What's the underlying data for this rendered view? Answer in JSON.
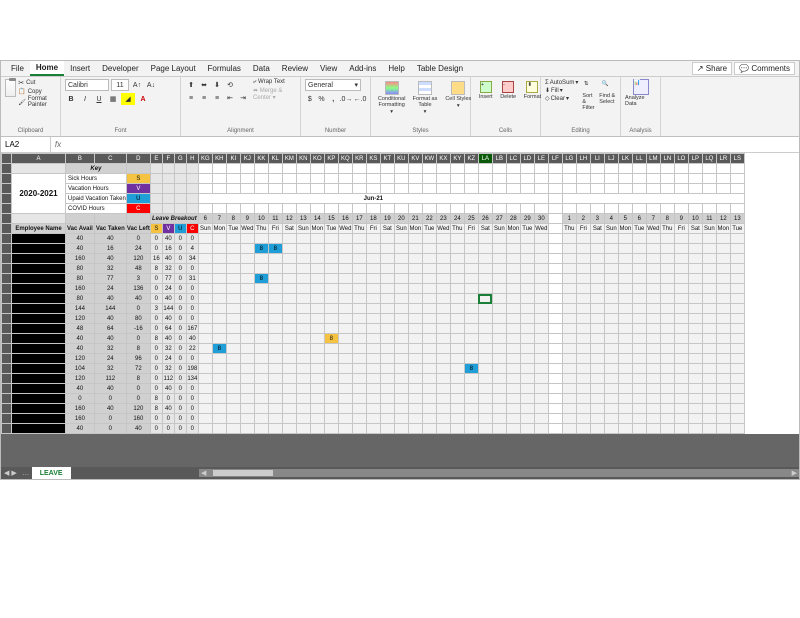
{
  "tabs": [
    "File",
    "Home",
    "Insert",
    "Developer",
    "Page Layout",
    "Formulas",
    "Data",
    "Review",
    "View",
    "Add-ins",
    "Help",
    "Table Design"
  ],
  "active_tab": "Home",
  "share": "Share",
  "comments": "Comments",
  "ribbon": {
    "clipboard": {
      "label": "Clipboard",
      "cut": "Cut",
      "copy": "Copy",
      "fp": "Format Painter"
    },
    "font": {
      "label": "Font",
      "name": "Calibri",
      "size": "11",
      "increase": "A",
      "decrease": "A"
    },
    "alignment": {
      "label": "Alignment",
      "wrap": "Wrap Text",
      "merge": "Merge & Center"
    },
    "number": {
      "label": "Number",
      "general": "General"
    },
    "styles": {
      "label": "Styles",
      "cond": "Conditional Formatting",
      "fat": "Format as Table",
      "cell": "Cell Styles"
    },
    "cells": {
      "label": "Cells",
      "insert": "Insert",
      "delete": "Delete",
      "format": "Format"
    },
    "editing": {
      "label": "Editing",
      "autosum": "AutoSum",
      "fill": "Fill",
      "clear": "Clear",
      "sort": "Sort & Filter",
      "find": "Find & Select"
    },
    "analysis": {
      "label": "Analysis",
      "analyze": "Analyze Data"
    }
  },
  "name_box": "LA2",
  "columns": [
    "A",
    "B",
    "C",
    "D",
    "E",
    "F",
    "G",
    "H",
    "KG",
    "KH",
    "KI",
    "KJ",
    "KK",
    "KL",
    "KM",
    "KN",
    "KO",
    "KP",
    "KQ",
    "KR",
    "KS",
    "KT",
    "KU",
    "KV",
    "KW",
    "KX",
    "KY",
    "KZ",
    "LA",
    "LB",
    "LC",
    "LD",
    "LE",
    "LF",
    "LG",
    "LH",
    "LI",
    "LJ",
    "LK",
    "LL",
    "LM",
    "LN",
    "LO",
    "LP",
    "LQ",
    "LR",
    "LS"
  ],
  "selected_col": "LA",
  "key": {
    "title": "Key",
    "rows": [
      {
        "label": "Sick Hours",
        "code": "S",
        "cls": "yellow"
      },
      {
        "label": "Vacation Hours",
        "code": "V",
        "cls": "purple"
      },
      {
        "label": "Upaid Vacation Taken",
        "code": "U",
        "cls": "blue"
      },
      {
        "label": "COVID Hours",
        "code": "C",
        "cls": "red"
      }
    ]
  },
  "year": "2020-2021",
  "leave_breakout": "Leave Breakout",
  "month": "Jun-21",
  "data_hdr": {
    "emp": "Employee Name",
    "va": "Vac Avail",
    "vt": "Vac Taken",
    "vl": "Vac Left",
    "s": "S",
    "v": "V",
    "u": "U",
    "c": "C"
  },
  "days": [
    "6",
    "7",
    "8",
    "9",
    "10",
    "11",
    "12",
    "13",
    "14",
    "15",
    "16",
    "17",
    "18",
    "19",
    "20",
    "21",
    "22",
    "23",
    "24",
    "25",
    "26",
    "27",
    "28",
    "29",
    "30",
    "",
    "1",
    "2",
    "3",
    "4",
    "5",
    "6",
    "7",
    "8",
    "9",
    "10",
    "11",
    "12",
    "13"
  ],
  "dow": [
    "Sun",
    "Mon",
    "Tue",
    "Wed",
    "Thu",
    "Fri",
    "Sat",
    "Sun",
    "Mon",
    "Tue",
    "Wed",
    "Thu",
    "Fri",
    "Sat",
    "Sun",
    "Mon",
    "Tue",
    "Wed",
    "Thu",
    "Fri",
    "Sat",
    "Sun",
    "Mon",
    "Tue",
    "Wed",
    "",
    "Thu",
    "Fri",
    "Sat",
    "Sun",
    "Mon",
    "Tue",
    "Wed",
    "Thu",
    "Fri",
    "Sat",
    "Sun",
    "Mon",
    "Tue"
  ],
  "rows": [
    {
      "va": "40",
      "vt": "40",
      "vl": "0",
      "s": "0",
      "v": "40",
      "u": "0",
      "c": "0",
      "cells": {}
    },
    {
      "va": "40",
      "vt": "16",
      "vl": "24",
      "s": "0",
      "v": "16",
      "u": "0",
      "c": "4",
      "cells": {
        "4": "8",
        "5": "8"
      }
    },
    {
      "va": "160",
      "vt": "40",
      "vl": "120",
      "s": "16",
      "v": "40",
      "u": "0",
      "c": "34",
      "cells": {}
    },
    {
      "va": "80",
      "vt": "32",
      "vl": "48",
      "s": "8",
      "v": "32",
      "u": "0",
      "c": "0",
      "cells": {}
    },
    {
      "va": "80",
      "vt": "77",
      "vl": "3",
      "s": "0",
      "v": "77",
      "u": "0",
      "c": "31",
      "cells": {
        "4": "8"
      }
    },
    {
      "va": "160",
      "vt": "24",
      "vl": "136",
      "s": "0",
      "v": "24",
      "u": "0",
      "c": "0",
      "cells": {}
    },
    {
      "va": "80",
      "vt": "40",
      "vl": "40",
      "s": "0",
      "v": "40",
      "u": "0",
      "c": "0",
      "cells": {}
    },
    {
      "va": "144",
      "vt": "144",
      "vl": "0",
      "s": "3",
      "v": "144",
      "u": "0",
      "c": "0",
      "cells": {}
    },
    {
      "va": "120",
      "vt": "40",
      "vl": "80",
      "s": "0",
      "v": "40",
      "u": "0",
      "c": "0",
      "cells": {}
    },
    {
      "va": "48",
      "vt": "64",
      "vl": "-16",
      "s": "0",
      "v": "64",
      "u": "0",
      "c": "167",
      "cells": {}
    },
    {
      "va": "40",
      "vt": "40",
      "vl": "0",
      "s": "8",
      "v": "40",
      "u": "0",
      "c": "40",
      "cells": {
        "9": "8",
        "cls9": "yellow"
      }
    },
    {
      "va": "40",
      "vt": "32",
      "vl": "8",
      "s": "0",
      "v": "32",
      "u": "0",
      "c": "22",
      "cells": {
        "1": "8"
      }
    },
    {
      "va": "120",
      "vt": "24",
      "vl": "96",
      "s": "0",
      "v": "24",
      "u": "0",
      "c": "0",
      "cells": {}
    },
    {
      "va": "104",
      "vt": "32",
      "vl": "72",
      "s": "0",
      "v": "32",
      "u": "0",
      "c": "198",
      "cells": {
        "19": "8"
      }
    },
    {
      "va": "120",
      "vt": "112",
      "vl": "8",
      "s": "0",
      "v": "112",
      "u": "0",
      "c": "134",
      "cells": {}
    },
    {
      "va": "40",
      "vt": "40",
      "vl": "0",
      "s": "0",
      "v": "40",
      "u": "0",
      "c": "0",
      "cells": {}
    },
    {
      "va": "0",
      "vt": "0",
      "vl": "0",
      "s": "8",
      "v": "0",
      "u": "0",
      "c": "0",
      "cells": {}
    },
    {
      "va": "160",
      "vt": "40",
      "vl": "120",
      "s": "8",
      "v": "40",
      "u": "0",
      "c": "0",
      "cells": {}
    },
    {
      "va": "160",
      "vt": "0",
      "vl": "160",
      "s": "0",
      "v": "0",
      "u": "0",
      "c": "0",
      "cells": {}
    },
    {
      "va": "40",
      "vt": "0",
      "vl": "40",
      "s": "0",
      "v": "0",
      "u": "0",
      "c": "0",
      "cells": {}
    }
  ],
  "sheet_tab": "LEAVE"
}
